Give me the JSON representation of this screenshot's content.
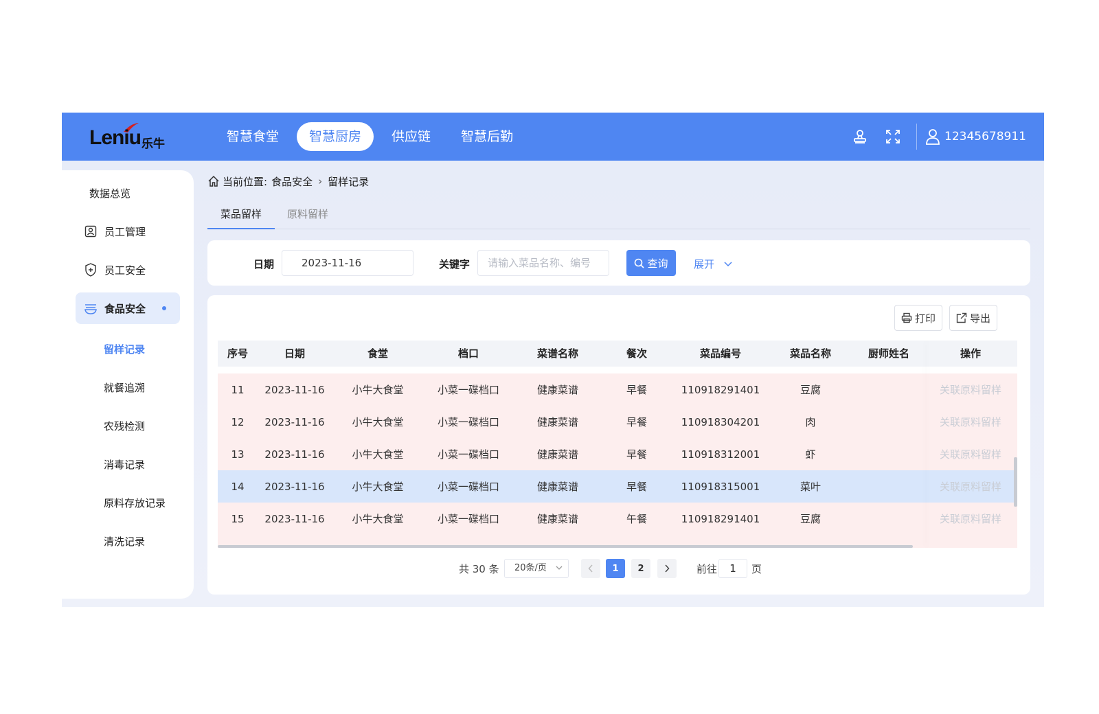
{
  "brand": {
    "latin": "Leniu",
    "cn": "乐牛"
  },
  "nav": {
    "items": [
      {
        "label": "智慧食堂",
        "active": false
      },
      {
        "label": "智慧厨房",
        "active": true
      },
      {
        "label": "供应链",
        "active": false
      },
      {
        "label": "智慧后勤",
        "active": false
      }
    ]
  },
  "user": {
    "account": "12345678911"
  },
  "sidebar": {
    "items": [
      {
        "label": "数据总览",
        "icon": "none"
      },
      {
        "label": "员工管理",
        "icon": "id-card-icon"
      },
      {
        "label": "员工安全",
        "icon": "shield-plus-icon"
      },
      {
        "label": "食品安全",
        "icon": "bowl-icon",
        "active": true
      }
    ],
    "sub_items": [
      {
        "label": "留样记录",
        "active": true
      },
      {
        "label": "就餐追溯"
      },
      {
        "label": "农残检测"
      },
      {
        "label": "消毒记录"
      },
      {
        "label": "原料存放记录"
      },
      {
        "label": "清洗记录"
      }
    ]
  },
  "breadcrumb": {
    "prefix": "当前位置:",
    "level1": "食品安全",
    "level2": "留样记录"
  },
  "tabs": [
    {
      "label": "菜品留样",
      "active": true
    },
    {
      "label": "原料留样",
      "active": false
    }
  ],
  "filter": {
    "date_label": "日期",
    "date_value": "2023-11-16",
    "keyword_label": "关键字",
    "keyword_placeholder": "请输入菜品名称、编号",
    "query_label": "查询",
    "expand_label": "展开"
  },
  "toolbar": {
    "print_label": "打印",
    "export_label": "导出"
  },
  "table": {
    "columns": [
      "序号",
      "日期",
      "食堂",
      "档口",
      "菜谱名称",
      "餐次",
      "菜品编号",
      "菜品名称",
      "厨师姓名",
      "操作"
    ],
    "rows": [
      {
        "no": "11",
        "date": "2023-11-16",
        "canteen": "小牛大食堂",
        "stall": "小菜一碟档口",
        "menu": "健康菜谱",
        "meal": "早餐",
        "code": "110918291401",
        "dish": "豆腐",
        "chef": "",
        "action": "关联原料留样"
      },
      {
        "no": "12",
        "date": "2023-11-16",
        "canteen": "小牛大食堂",
        "stall": "小菜一碟档口",
        "menu": "健康菜谱",
        "meal": "早餐",
        "code": "110918304201",
        "dish": "肉",
        "chef": "",
        "action": "关联原料留样"
      },
      {
        "no": "13",
        "date": "2023-11-16",
        "canteen": "小牛大食堂",
        "stall": "小菜一碟档口",
        "menu": "健康菜谱",
        "meal": "早餐",
        "code": "110918312001",
        "dish": "虾",
        "chef": "",
        "action": "关联原料留样"
      },
      {
        "no": "14",
        "date": "2023-11-16",
        "canteen": "小牛大食堂",
        "stall": "小菜一碟档口",
        "menu": "健康菜谱",
        "meal": "早餐",
        "code": "110918315001",
        "dish": "菜叶",
        "chef": "",
        "action": "关联原料留样",
        "highlight": true
      },
      {
        "no": "15",
        "date": "2023-11-16",
        "canteen": "小牛大食堂",
        "stall": "小菜一碟档口",
        "menu": "健康菜谱",
        "meal": "午餐",
        "code": "110918291401",
        "dish": "豆腐",
        "chef": "",
        "action": "关联原料留样"
      }
    ]
  },
  "pagination": {
    "total_text": "共 30 条",
    "page_size": "20条/页",
    "pages": [
      "1",
      "2"
    ],
    "current": "1",
    "goto_label": "前往",
    "goto_value": "1",
    "page_suffix": "页"
  },
  "colors": {
    "primary": "#4f86f2",
    "row_bg": "#fdeeee",
    "row_highlight": "#d8e6fb"
  }
}
